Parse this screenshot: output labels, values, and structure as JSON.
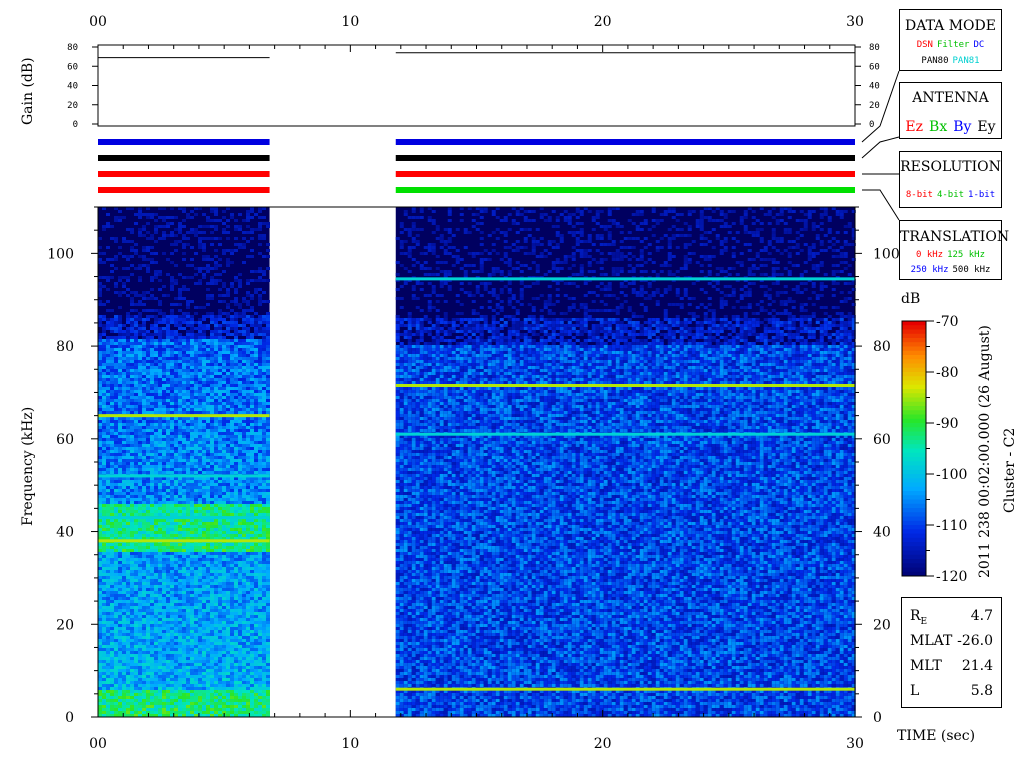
{
  "chart_data": [
    {
      "type": "line",
      "panel": "gain",
      "ylabel": "Gain (dB)",
      "ylim": [
        0,
        80
      ],
      "yticks": [
        "0",
        "20",
        "40",
        "60",
        "80"
      ],
      "xlim": [
        0,
        30
      ],
      "xticks": [
        "00",
        "10",
        "20",
        "30"
      ],
      "series": [
        {
          "x": [
            0,
            6.8
          ],
          "y": [
            69,
            69
          ]
        },
        {
          "x": [
            11.8,
            30
          ],
          "y": [
            74,
            74
          ]
        }
      ]
    },
    {
      "type": "heatmap",
      "panel": "spectrogram",
      "ylabel": "Frequency (kHz)",
      "xlabel": "TIME (sec)",
      "xlim": [
        0,
        30
      ],
      "ylim": [
        0,
        110
      ],
      "xticks": [
        "00",
        "10",
        "20",
        "30"
      ],
      "yticks": [
        "0",
        "20",
        "40",
        "60",
        "80",
        "100"
      ],
      "data_gaps": [
        [
          6.8,
          11.8
        ]
      ],
      "segments": [
        {
          "x_start": 0,
          "x_end": 6.8,
          "lines_khz": [
            65,
            38,
            43,
            52
          ],
          "noise_ceiling_khz": 85
        },
        {
          "x_start": 11.8,
          "x_end": 30,
          "lines_khz": [
            71.5,
            61,
            6,
            94.5
          ],
          "noise_ceiling_khz": 84
        }
      ],
      "colorbar": {
        "label": "dB",
        "range": [
          -120,
          -70
        ],
        "ticks": [
          "-70",
          "-80",
          "-90",
          "-100",
          "-110",
          "-120"
        ]
      }
    }
  ],
  "mode_bars": {
    "segment1": [
      "#0000e0",
      "#000000",
      "#ff0000",
      "#ff0000"
    ],
    "segment2": [
      "#0000e0",
      "#000000",
      "#ff0000",
      "#00e000"
    ]
  },
  "side_text": {
    "timestamp": "2011 238 00:02:00.000 (26 August)",
    "spacecraft": "Cluster - C2"
  },
  "legend": {
    "data_mode": {
      "title": "DATA MODE",
      "row1": [
        {
          "text": "DSN",
          "color": "#ff0000"
        },
        {
          "text": "Filter",
          "color": "#00c000"
        },
        {
          "text": "DC",
          "color": "#0000ff"
        }
      ],
      "row2": [
        {
          "text": "PAN80",
          "color": "#000000"
        },
        {
          "text": "PAN81",
          "color": "#00d0d0"
        }
      ]
    },
    "antenna": {
      "title": "ANTENNA",
      "items": [
        {
          "text": "Ez",
          "color": "#ff0000"
        },
        {
          "text": "Bx",
          "color": "#00c000"
        },
        {
          "text": "By",
          "color": "#0000ff"
        },
        {
          "text": "Ey",
          "color": "#000000"
        }
      ]
    },
    "resolution": {
      "title": "RESOLUTION",
      "items": [
        {
          "text": "8-bit",
          "color": "#ff0000"
        },
        {
          "text": "4-bit",
          "color": "#00c000"
        },
        {
          "text": "1-bit",
          "color": "#0000ff"
        }
      ]
    },
    "translation": {
      "title": "TRANSLATION",
      "row1": [
        {
          "text": "0 kHz",
          "color": "#ff0000"
        },
        {
          "text": "125 kHz",
          "color": "#00c000"
        }
      ],
      "row2": [
        {
          "text": "250 kHz",
          "color": "#0000ff"
        },
        {
          "text": "500 kHz",
          "color": "#000000"
        }
      ]
    }
  },
  "ephemeris": [
    {
      "key": "R",
      "sub": "E",
      "value": "4.7"
    },
    {
      "key": "MLAT",
      "sub": "",
      "value": "-26.0"
    },
    {
      "key": "MLT",
      "sub": "",
      "value": "21.4"
    },
    {
      "key": "L",
      "sub": "",
      "value": "5.8"
    }
  ]
}
